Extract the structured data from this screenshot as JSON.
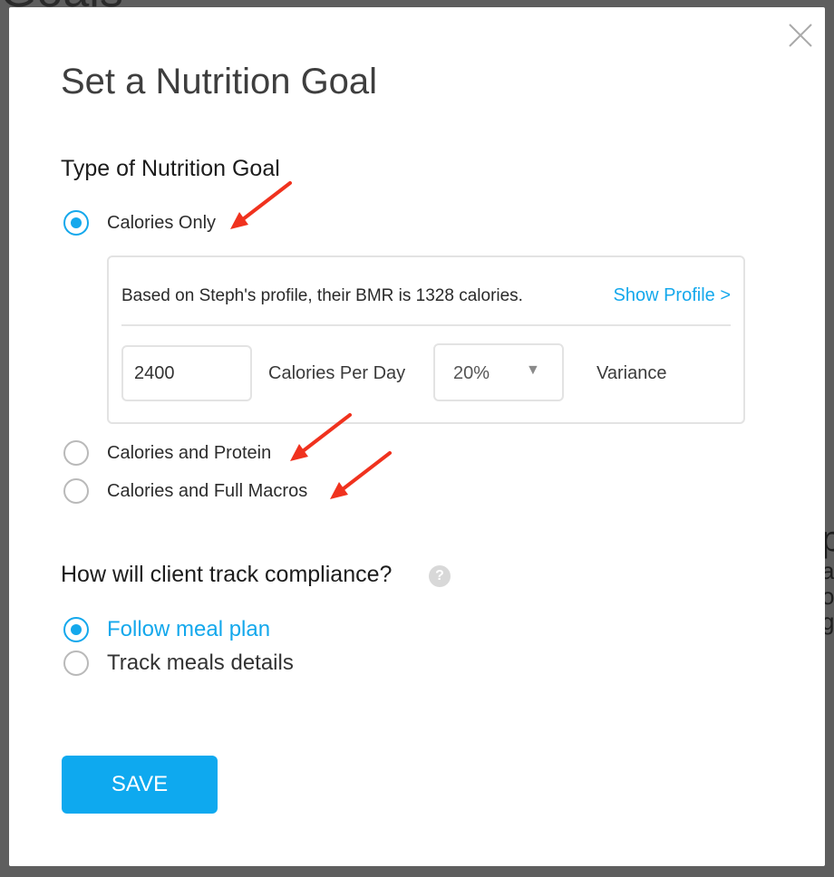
{
  "background": {
    "title_fragment": "Goals",
    "right_letters": [
      "p",
      "a",
      "o",
      "g"
    ]
  },
  "modal": {
    "title": "Set a Nutrition Goal",
    "goal_type": {
      "heading": "Type of Nutrition Goal",
      "options": [
        {
          "label": "Calories Only",
          "selected": true
        },
        {
          "label": "Calories and Protein",
          "selected": false
        },
        {
          "label": "Calories and Full Macros",
          "selected": false
        }
      ],
      "calories_panel": {
        "bmr_text": "Based on Steph's profile, their BMR is 1328 calories.",
        "show_profile_link": "Show Profile >",
        "calories_value": "2400",
        "calories_label": "Calories Per Day",
        "variance_value": "20%",
        "variance_label": "Variance"
      }
    },
    "compliance": {
      "heading": "How will client track compliance?",
      "help_icon": "?",
      "options": [
        {
          "label": "Follow meal plan",
          "selected": true
        },
        {
          "label": "Track meals details",
          "selected": false
        }
      ]
    },
    "save_label": "SAVE"
  },
  "colors": {
    "accent": "#14a8ec",
    "button": "#0ea9ef",
    "annotation_arrow": "#f0321e",
    "overlay": "#5e5e5e"
  },
  "icons": {
    "close": "close-icon",
    "help": "question-mark-icon",
    "dropdown": "caret-down-icon",
    "annotation": "red-arrow-icon"
  }
}
